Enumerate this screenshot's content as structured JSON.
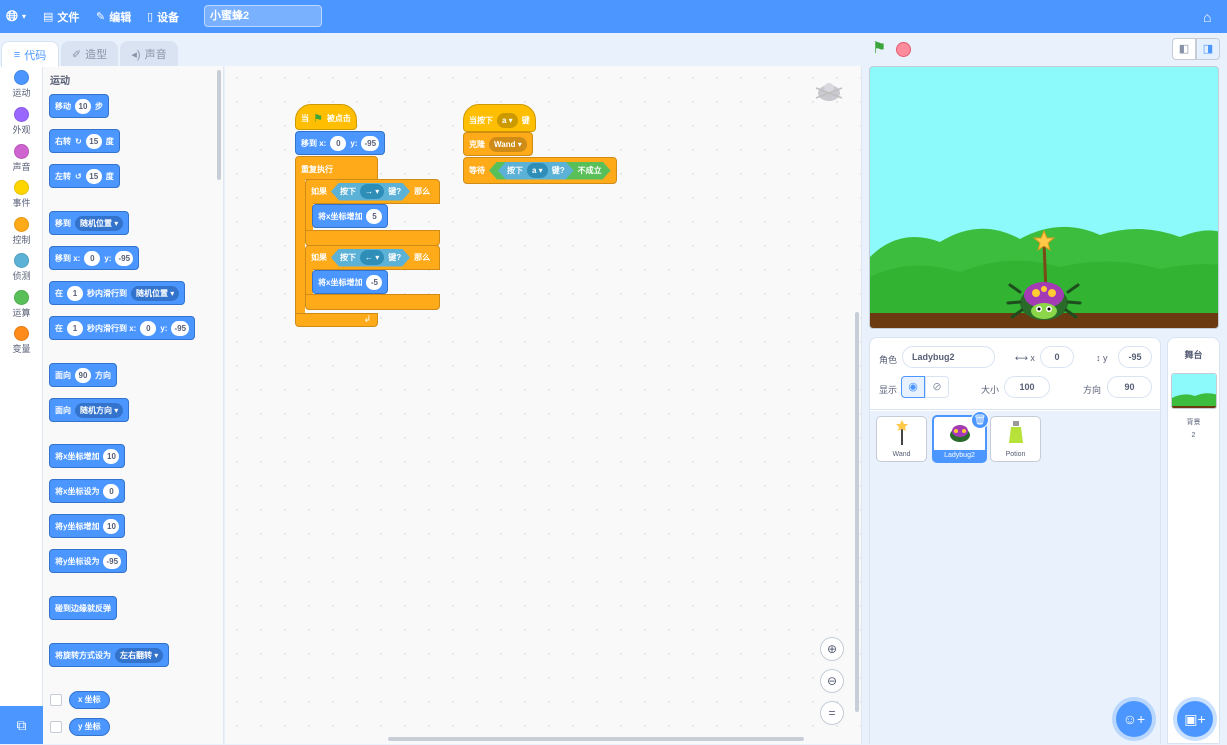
{
  "menubar": {
    "file": "文件",
    "edit": "编辑",
    "device": "设备",
    "project_title": "小蜜蜂2"
  },
  "tabs": {
    "code": "代码",
    "costumes": "造型",
    "sounds": "声音"
  },
  "categories": [
    {
      "label": "运动",
      "color": "#4c97ff"
    },
    {
      "label": "外观",
      "color": "#9966ff"
    },
    {
      "label": "声音",
      "color": "#cf63cf"
    },
    {
      "label": "事件",
      "color": "#ffd500"
    },
    {
      "label": "控制",
      "color": "#ffab19"
    },
    {
      "label": "侦测",
      "color": "#5cb1d6"
    },
    {
      "label": "运算",
      "color": "#59c059"
    },
    {
      "label": "变量",
      "color": "#ff8c1a"
    }
  ],
  "palette": {
    "heading": "运动",
    "move": {
      "a": "移动",
      "n": "10",
      "b": "步"
    },
    "turn_right": {
      "a": "右转",
      "n": "15",
      "b": "度"
    },
    "turn_left": {
      "a": "左转",
      "n": "15",
      "b": "度"
    },
    "goto": {
      "a": "移到",
      "dd": "随机位置"
    },
    "goto_xy": {
      "a": "移到 x:",
      "x": "0",
      "ylabel": "y:",
      "y": "-95"
    },
    "glide_to": {
      "a": "在",
      "n": "1",
      "b": "秒内滑行到",
      "dd": "随机位置"
    },
    "glide_xy": {
      "a": "在",
      "n": "1",
      "b": "秒内滑行到 x:",
      "x": "0",
      "ylabel": "y:",
      "y": "-95"
    },
    "point_dir": {
      "a": "面向",
      "n": "90",
      "b": "方向"
    },
    "point_towards": {
      "a": "面向",
      "dd": "随机方向"
    },
    "change_x": {
      "a": "将x坐标增加",
      "n": "10"
    },
    "set_x": {
      "a": "将x坐标设为",
      "n": "0"
    },
    "change_y": {
      "a": "将y坐标增加",
      "n": "10"
    },
    "set_y": {
      "a": "将y坐标设为",
      "n": "-95"
    },
    "bounce": "碰到边缘就反弹",
    "rotation_style": {
      "a": "将旋转方式设为",
      "dd": "左右翻转"
    },
    "rep_x": "x 坐标",
    "rep_y": "y 坐标"
  },
  "script1": {
    "hat_a": "当",
    "hat_b": "被点击",
    "goto": {
      "a": "移到 x:",
      "x": "0",
      "ylabel": "y:",
      "y": "-95"
    },
    "forever": "重复执行",
    "if1": {
      "a": "如果",
      "sense": "按下",
      "key": "→",
      "b": "键?",
      "c": "那么"
    },
    "change1": {
      "a": "将x坐标增加",
      "n": "5"
    },
    "if2": {
      "a": "如果",
      "sense": "按下",
      "key": "←",
      "b": "键?",
      "c": "那么"
    },
    "change2": {
      "a": "将x坐标增加",
      "n": "-5"
    }
  },
  "script2": {
    "hat": {
      "a": "当按下",
      "key": "a",
      "b": "键"
    },
    "clone": {
      "a": "克隆",
      "dd": "Wand"
    },
    "wait": {
      "a": "等待",
      "sense": "按下",
      "key": "a",
      "b": "键?",
      "c": "不成立"
    }
  },
  "sprite_info": {
    "sprite_label": "角色",
    "sprite_name": "Ladybug2",
    "x_label": "x",
    "x": "0",
    "y_label": "y",
    "y": "-95",
    "show_label": "显示",
    "size_label": "大小",
    "size": "100",
    "direction_label": "方向",
    "direction": "90"
  },
  "sprites": [
    {
      "name": "Wand",
      "selected": false
    },
    {
      "name": "Ladybug2",
      "selected": true
    },
    {
      "name": "Potion",
      "selected": false
    }
  ],
  "stage_panel": {
    "title": "舞台",
    "backdrops_label": "背景",
    "backdrops_count": "2"
  },
  "colors": {
    "menubar": "#4c97ff",
    "motion": "#4c97ff",
    "control": "#ffab19",
    "events": "#ffbf00",
    "sensing": "#5cb1d6"
  }
}
